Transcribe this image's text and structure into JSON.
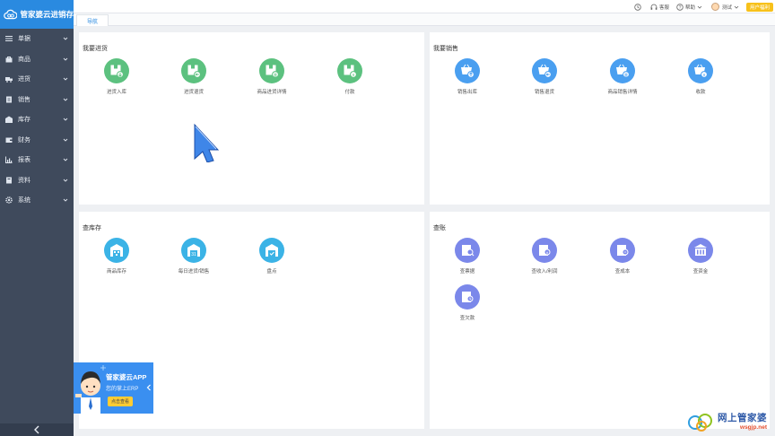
{
  "app": {
    "title": "管家婆云进销存"
  },
  "sidebar": {
    "items": [
      {
        "label": "单据",
        "icon": "list-icon"
      },
      {
        "label": "商品",
        "icon": "bag-icon"
      },
      {
        "label": "进货",
        "icon": "truck-icon"
      },
      {
        "label": "销售",
        "icon": "document-icon"
      },
      {
        "label": "库存",
        "icon": "warehouse-icon"
      },
      {
        "label": "财务",
        "icon": "wallet-icon"
      },
      {
        "label": "报表",
        "icon": "bar-chart-icon"
      },
      {
        "label": "资料",
        "icon": "folder-icon"
      },
      {
        "label": "系统",
        "icon": "gear-icon"
      }
    ]
  },
  "topbar": {
    "service_label": "客服",
    "help_label": "帮助",
    "user_label": "测试",
    "vip_label": "用户福利"
  },
  "tabs": {
    "nav_label": "导航"
  },
  "panels": {
    "purchase": {
      "title": "我要进货",
      "items": [
        {
          "label": "进货入库",
          "icon": "box-in-icon"
        },
        {
          "label": "进货退货",
          "icon": "box-return-icon"
        },
        {
          "label": "商品进货详情",
          "icon": "box-detail-icon"
        },
        {
          "label": "付款",
          "icon": "box-pay-icon"
        }
      ]
    },
    "sales": {
      "title": "我要销售",
      "items": [
        {
          "label": "销售出库",
          "icon": "basket-out-icon"
        },
        {
          "label": "销售退货",
          "icon": "basket-return-icon"
        },
        {
          "label": "商品销售详情",
          "icon": "basket-detail-icon"
        },
        {
          "label": "收款",
          "icon": "basket-receive-icon"
        }
      ]
    },
    "inventory": {
      "title": "查库存",
      "items": [
        {
          "label": "商品库存",
          "icon": "warehouse-stock-icon"
        },
        {
          "label": "每日进货/销售",
          "icon": "warehouse-daily-icon"
        },
        {
          "label": "盘点",
          "icon": "warehouse-check-icon"
        }
      ]
    },
    "accounts": {
      "title": "查账",
      "items": [
        {
          "label": "查票据",
          "icon": "bill-icon"
        },
        {
          "label": "查收入/利润",
          "icon": "income-icon"
        },
        {
          "label": "查成本",
          "icon": "cost-icon"
        },
        {
          "label": "查资金",
          "icon": "bank-icon"
        },
        {
          "label": "查欠款",
          "icon": "debt-icon"
        }
      ]
    }
  },
  "promo": {
    "title": "管家婆云APP",
    "subtitle": "您的掌上ERP",
    "button": "点击查看"
  },
  "watermark": {
    "title": "网上管家婆",
    "url": "wsgjp.net"
  },
  "colors": {
    "sidebar_bg": "#3f4a5c",
    "brand_blue": "#2a8ae0",
    "green": "#5cc17f",
    "blue": "#4a9ff0",
    "sky": "#3bb3e6",
    "purple": "#7b88ea",
    "vip_yellow": "#f7c11b"
  }
}
